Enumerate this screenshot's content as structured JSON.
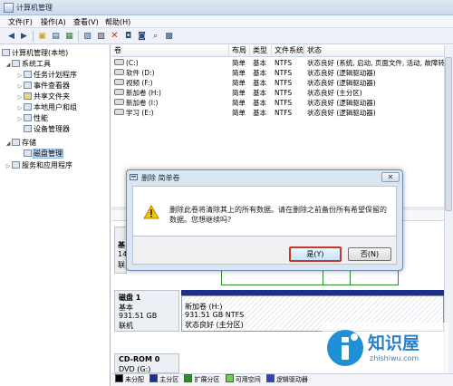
{
  "window": {
    "title": "计算机管理"
  },
  "menu": [
    "文件(F)",
    "操作(A)",
    "查看(V)",
    "帮助(H)"
  ],
  "tree": {
    "root": "计算机管理(本地)",
    "system_tools": "系统工具",
    "items": [
      "任务计划程序",
      "事件查看器",
      "共享文件夹",
      "本地用户和组",
      "性能",
      "设备管理器"
    ],
    "storage": "存储",
    "disk_mgmt": "磁盘管理",
    "services": "服务和应用程序"
  },
  "list": {
    "headers": [
      "卷",
      "布局",
      "类型",
      "文件系统",
      "状态"
    ],
    "rows": [
      {
        "vol": "(C:)",
        "layout": "简单",
        "type": "基本",
        "fs": "NTFS",
        "status": "状态良好 (系统, 启动, 页面文件, 活动, 故障转"
      },
      {
        "vol": "软件 (D:)",
        "layout": "简单",
        "type": "基本",
        "fs": "NTFS",
        "status": "状态良好 (逻辑驱动器)"
      },
      {
        "vol": "视频 (F:)",
        "layout": "简单",
        "type": "基本",
        "fs": "NTFS",
        "status": "状态良好 (逻辑驱动器)"
      },
      {
        "vol": "新加卷 (H:)",
        "layout": "简单",
        "type": "基本",
        "fs": "NTFS",
        "status": "状态良好 (主分区)"
      },
      {
        "vol": "新加卷 (I:)",
        "layout": "简单",
        "type": "基本",
        "fs": "NTFS",
        "status": "状态良好 (逻辑驱动器)"
      },
      {
        "vol": "学习 (E:)",
        "layout": "简单",
        "type": "基本",
        "fs": "NTFS",
        "status": "状态良好 (逻辑驱动器)"
      }
    ]
  },
  "disks": {
    "disk0_partial": [
      "基",
      "14",
      "联"
    ],
    "disk1": {
      "name": "磁盘 1",
      "type": "基本",
      "size": "931.51 GB",
      "state": "联机"
    },
    "disk1_part": {
      "name": "新加卷  (H:)",
      "size": "931.51 GB NTFS",
      "status": "状态良好 (主分区)"
    },
    "cdrom": {
      "name": "CD-ROM 0",
      "drive": "DVD (G:)"
    }
  },
  "legend": [
    {
      "label": "未分配",
      "color": "#000000"
    },
    {
      "label": "主分区",
      "color": "#1c2f8a"
    },
    {
      "label": "扩展分区",
      "color": "#2e8b2e"
    },
    {
      "label": "可用空间",
      "color": "#7ec850"
    },
    {
      "label": "逻辑驱动器",
      "color": "#2f3fd1"
    }
  ],
  "dialog": {
    "title": "删除 简单卷",
    "message": "删除此卷将清除其上的所有数据。请在删除之前备份所有希望保留的数据。您想继续吗?",
    "yes": "是(Y)",
    "no": "否(N)",
    "close": "✕"
  },
  "watermark": {
    "text": "知识屋",
    "url": "zhishiwu.com"
  }
}
